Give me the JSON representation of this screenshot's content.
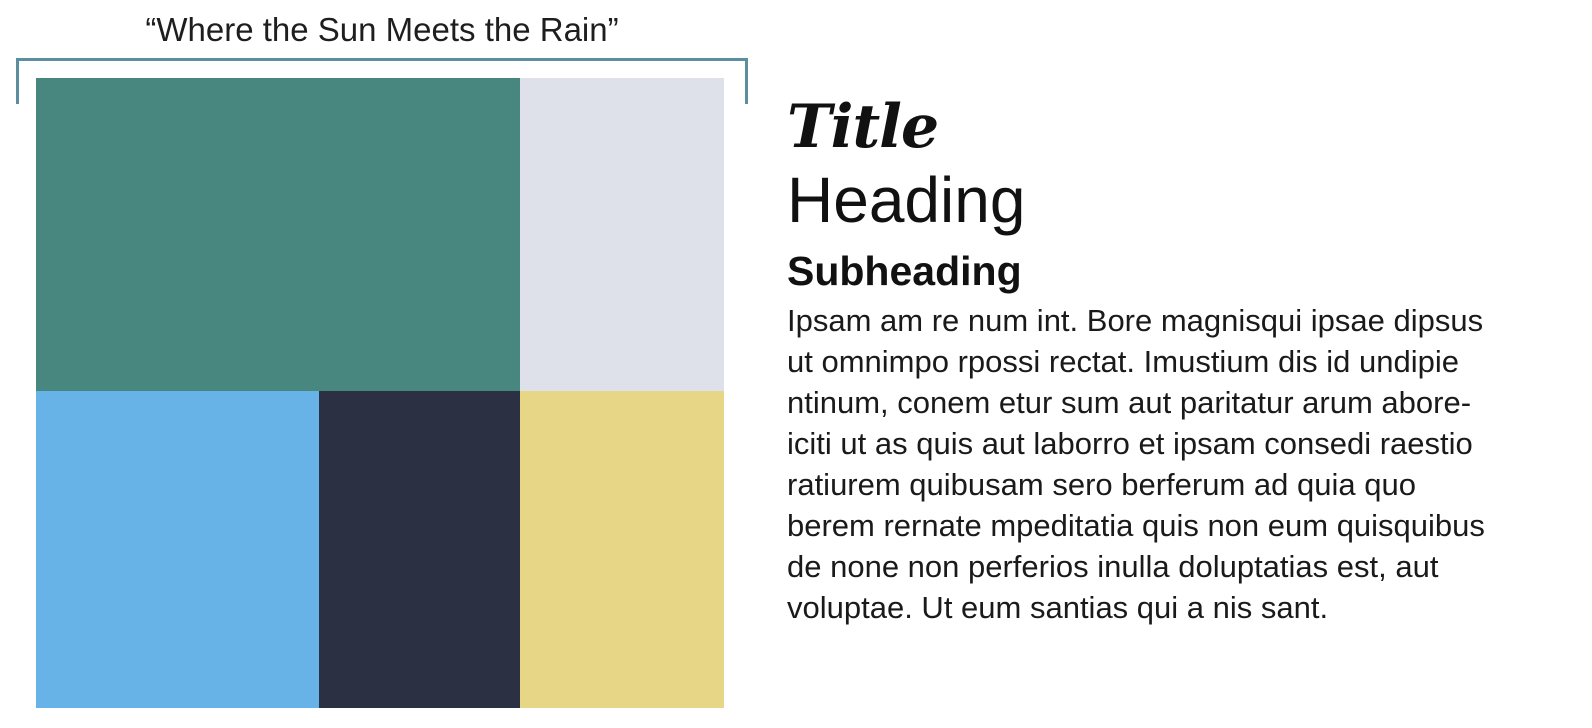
{
  "palette": {
    "caption": "“Where the Sun Meets the Rain”",
    "accent_color": "#5b8fa0",
    "swatches": [
      {
        "name": "teal",
        "color": "#48877f"
      },
      {
        "name": "light-gray",
        "color": "#dee1ea"
      },
      {
        "name": "sky-blue",
        "color": "#67b3e8"
      },
      {
        "name": "navy",
        "color": "#2b3142"
      },
      {
        "name": "yellow",
        "color": "#e8d687"
      }
    ]
  },
  "typography": {
    "title": "Title",
    "heading": "Heading",
    "subheading": "Subheading",
    "body_lines": [
      "Ipsam am re num int. Bore magnisqui ipsae dipsus",
      "ut omnimpo rpossi rectat. Imustium dis id undipie",
      "ntinum, conem etur sum aut paritatur arum abore-",
      "iciti ut as quis aut laborro et ipsam consedi raestio",
      "ratiurem quibusam sero berferum ad quia quo",
      "berem rernate mpeditatia quis non eum quisquibus",
      "de none non perferios inulla doluptatias est, aut",
      "voluptae. Ut eum santias qui a nis sant."
    ]
  }
}
